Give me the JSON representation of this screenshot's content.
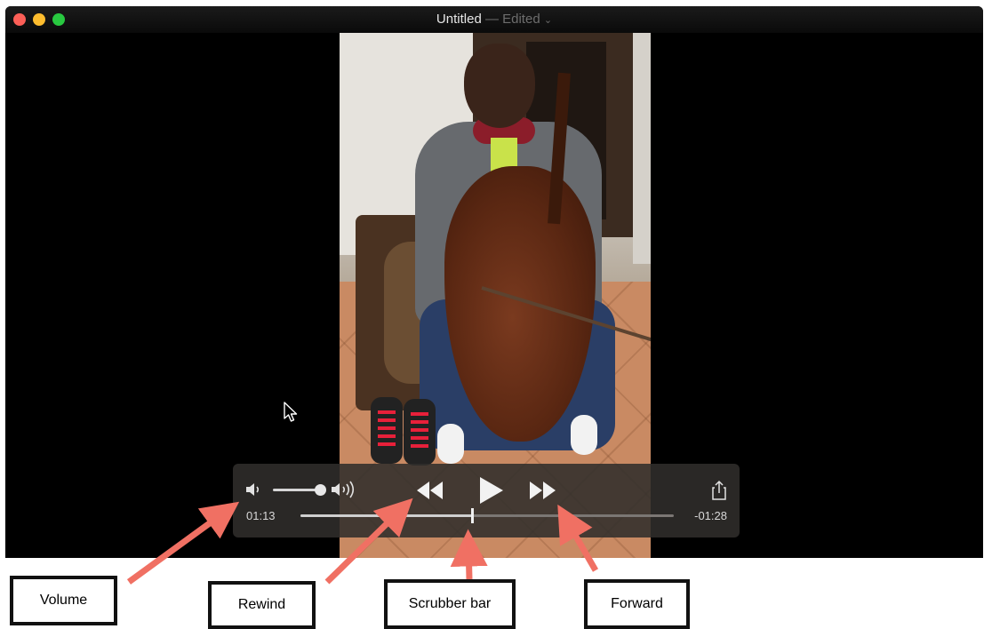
{
  "window": {
    "title": "Untitled",
    "title_separator": "—",
    "title_status": "Edited",
    "title_chevron": "⌄",
    "traffic_colors": {
      "close": "#fc5f57",
      "minimize": "#fdbc2e",
      "maximize": "#28c840"
    }
  },
  "controls": {
    "volume_low_icon": "speaker-low-icon",
    "volume_high_icon": "speaker-high-icon",
    "volume_level": 0.85,
    "rewind_icon": "rewind-icon",
    "play_icon": "play-icon",
    "forward_icon": "fast-forward-icon",
    "share_icon": "share-icon",
    "elapsed": "01:13",
    "remaining": "-01:28",
    "progress": 0.46
  },
  "callouts": {
    "volume": "Volume",
    "rewind": "Rewind",
    "scrubber": "Scrubber bar",
    "forward": "Forward",
    "arrow_color": "#f07063"
  }
}
